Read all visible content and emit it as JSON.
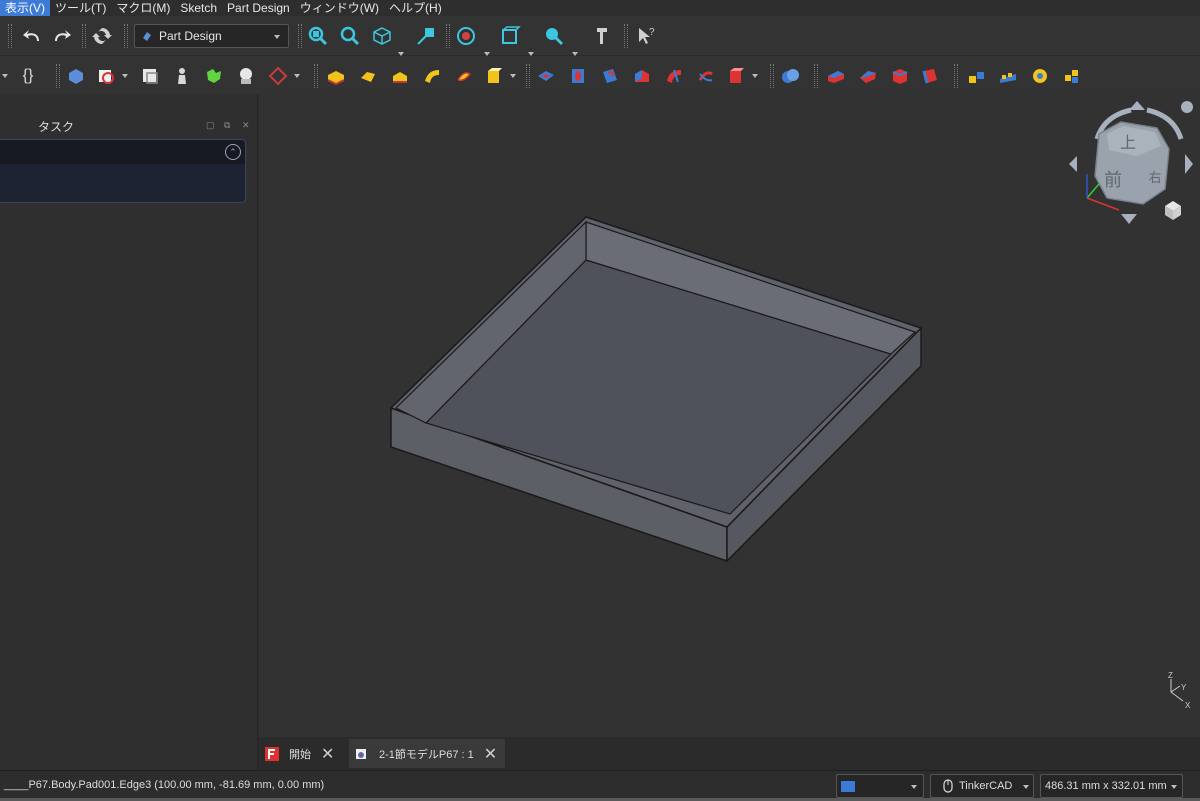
{
  "menubar": {
    "items": [
      {
        "label": "表示(V)",
        "active": true
      },
      {
        "label": "ツール(T)",
        "active": false
      },
      {
        "label": "マクロ(M)",
        "active": false
      },
      {
        "label": "Sketch",
        "active": false
      },
      {
        "label": "Part Design",
        "active": false
      },
      {
        "label": "ウィンドウ(W)",
        "active": false
      },
      {
        "label": "ヘルプ(H)",
        "active": false
      }
    ]
  },
  "toolbar": {
    "workbench": "Part Design",
    "icons": [
      "undo-icon",
      "redo-icon",
      "refresh-icon",
      "zoom-fit-all-icon",
      "zoom-selection-icon",
      "axonometric-view-icon",
      "measure-icon",
      "draw-style-icon",
      "bounding-box-icon",
      "zoom-icon",
      "measure-tool-icon",
      "whats-this-icon"
    ]
  },
  "toolbar2": {
    "icons": [
      "braces-icon",
      "create-body-icon",
      "create-sketch-icon",
      "validate-sketch-icon",
      "clone-icon",
      "shape-binder-icon",
      "subshape-binder-icon",
      "datum-plane-icon",
      "pad-icon",
      "revolution-icon",
      "loft-icon",
      "pipe-icon",
      "helix-icon",
      "additive-primitive-icon",
      "pocket-icon",
      "hole-icon",
      "groove-icon",
      "subtractive-loft-icon",
      "subtractive-pipe-icon",
      "subtractive-helix-icon",
      "subtractive-primitive-icon",
      "boolean-icon",
      "fillet-icon",
      "chamfer-icon",
      "draft-icon",
      "thickness-icon",
      "mirrored-icon",
      "linear-pattern-icon",
      "polar-pattern-icon",
      "multitransform-icon"
    ]
  },
  "left_panel": {
    "title": "タスク"
  },
  "navcube": {
    "top_label": "上",
    "front_label": "前",
    "right_label": "右"
  },
  "mini_axis": {
    "z": "Z",
    "y": "Y",
    "x": "X"
  },
  "tabs": [
    {
      "label": "開始",
      "active": false
    },
    {
      "label": "2-1節モデルP67 : 1",
      "active": true
    }
  ],
  "statusbar": {
    "message": "____P67.Body.Pad001.Edge3 (100.00 mm, -81.69 mm, 0.00 mm)",
    "navigation_style": "TinkerCAD",
    "dimensions": "486.31 mm x 332.01 mm"
  },
  "colors": {
    "accent": "#3d7bd6",
    "background": "#323232",
    "model_face": "#5c5f66",
    "model_top_face": "#4f525a"
  }
}
